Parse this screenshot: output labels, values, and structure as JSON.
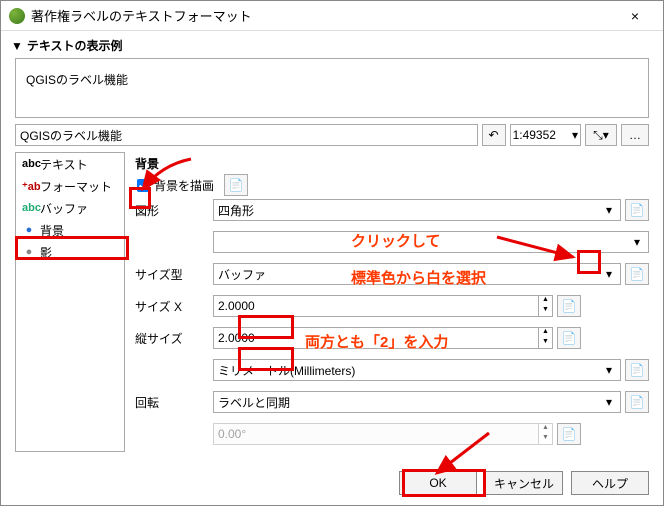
{
  "window": {
    "title": "著作権ラベルのテキストフォーマット",
    "close": "×"
  },
  "section": {
    "preview_head": "テキストの表示例"
  },
  "preview_text": "QGISのラベル機能",
  "toolbar": {
    "text_value": "QGISのラベル機能",
    "undo_icon": "↶",
    "scale": "1:49352",
    "pointer_icon": "⤡",
    "btn2": "…"
  },
  "sidebar": {
    "items": [
      {
        "icon": "abc",
        "label": "テキスト",
        "color": "#000"
      },
      {
        "icon": "⁺ab",
        "label": "フォーマット",
        "color": "#b00"
      },
      {
        "icon": "abc",
        "label": "バッファ",
        "color": "#2a7"
      },
      {
        "icon": "●",
        "label": "背景",
        "color": "#2a6fd6"
      },
      {
        "icon": "●",
        "label": "影",
        "color": "#888"
      }
    ]
  },
  "pane": {
    "header": "背景",
    "draw_label": "背景を描画",
    "override_glyph": "📄",
    "shape_label": "図形",
    "shape_value": "四角形",
    "style_value": "",
    "size_type_label": "サイズ型",
    "size_type_value": "バッファ",
    "size_x_label": "サイズ X",
    "size_x_value": "2.0000",
    "size_y_label": "縦サイズ",
    "size_y_value": "2.0000",
    "unit_value": "ミリメートル(Millimeters)",
    "rotation_label": "回転",
    "rotation_value": "ラベルと同期",
    "angle_value": "0.00°"
  },
  "buttons": {
    "ok": "OK",
    "cancel": "キャンセル",
    "help": "ヘルプ"
  },
  "annotations": {
    "click_line1": "クリックして",
    "click_line2": "標準色から白を選択",
    "size_note": "両方とも「2」を入力"
  }
}
